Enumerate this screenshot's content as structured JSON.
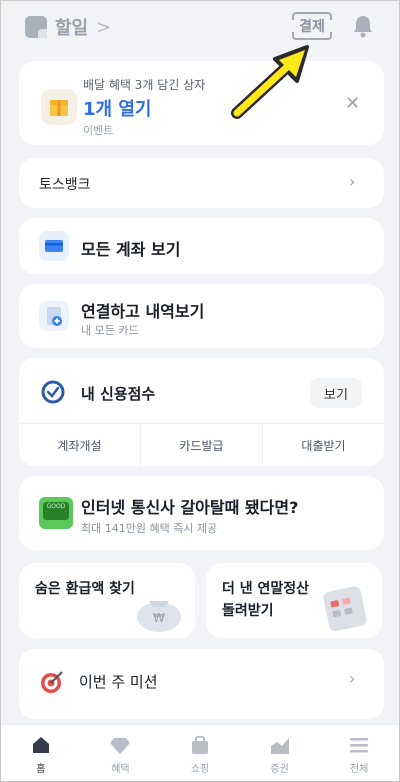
{
  "header": {
    "title": "할일",
    "chevron": ">",
    "pay_label": "결제"
  },
  "event_card": {
    "subtitle": "배달 혜택 3개 담긴 상자",
    "main_label": "1개 열기",
    "tag": "이벤트",
    "close": "✕"
  },
  "toss_bank": {
    "label": "토스뱅크",
    "chevron": "›"
  },
  "accounts": {
    "label": "모든 계좌 보기"
  },
  "connect": {
    "label": "연결하고 내역보기",
    "sub": "내 모든 카드"
  },
  "credit": {
    "label": "내 신용점수",
    "view_button": "보기",
    "quick_actions": [
      "계좌개설",
      "카드발급",
      "대출받기"
    ]
  },
  "telecom": {
    "label": "인터넷 통신사 갈아탈때 됐다면?",
    "sub": "최대 141만원 혜택 즉시 제공"
  },
  "half_cards": [
    {
      "label": "숨은 환급액 찾기"
    },
    {
      "label": "더 낸 연말정산 돌려받기"
    }
  ],
  "mission": {
    "label": "이번 주 미션",
    "chevron": "›"
  },
  "bottom_nav": {
    "items": [
      {
        "label": "홈",
        "icon": "home-icon"
      },
      {
        "label": "혜택",
        "icon": "gem-icon"
      },
      {
        "label": "쇼핑",
        "icon": "shopping-bag-icon"
      },
      {
        "label": "증권",
        "icon": "chart-icon"
      },
      {
        "label": "전체",
        "icon": "menu-icon"
      }
    ]
  },
  "colors": {
    "accent": "#2f6ce5",
    "annotation_arrow": "#ffe81a"
  }
}
